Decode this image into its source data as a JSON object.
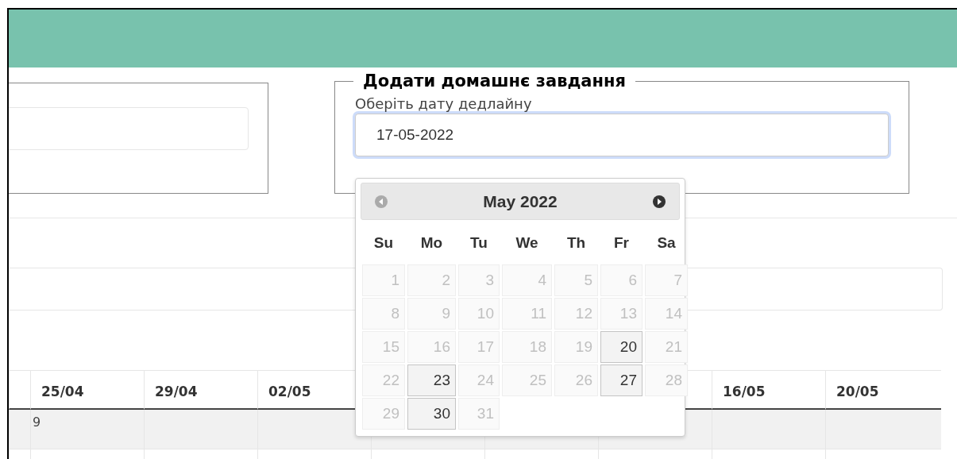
{
  "form": {
    "legend": "Додати домашнє завдання",
    "label": "Оберіть дату дедлайну",
    "date_value": "17-05-2022"
  },
  "datepicker": {
    "title": "May 2022",
    "prev_disabled": true,
    "next_disabled": false,
    "weekdays": [
      "Su",
      "Mo",
      "Tu",
      "We",
      "Th",
      "Fr",
      "Sa"
    ],
    "days": [
      {
        "label": "1",
        "enabled": false
      },
      {
        "label": "2",
        "enabled": false
      },
      {
        "label": "3",
        "enabled": false
      },
      {
        "label": "4",
        "enabled": false
      },
      {
        "label": "5",
        "enabled": false
      },
      {
        "label": "6",
        "enabled": false
      },
      {
        "label": "7",
        "enabled": false
      },
      {
        "label": "8",
        "enabled": false
      },
      {
        "label": "9",
        "enabled": false
      },
      {
        "label": "10",
        "enabled": false
      },
      {
        "label": "11",
        "enabled": false
      },
      {
        "label": "12",
        "enabled": false
      },
      {
        "label": "13",
        "enabled": false
      },
      {
        "label": "14",
        "enabled": false
      },
      {
        "label": "15",
        "enabled": false
      },
      {
        "label": "16",
        "enabled": false
      },
      {
        "label": "17",
        "enabled": false
      },
      {
        "label": "18",
        "enabled": false
      },
      {
        "label": "19",
        "enabled": false
      },
      {
        "label": "20",
        "enabled": true
      },
      {
        "label": "21",
        "enabled": false
      },
      {
        "label": "22",
        "enabled": false
      },
      {
        "label": "23",
        "enabled": true
      },
      {
        "label": "24",
        "enabled": false
      },
      {
        "label": "25",
        "enabled": false
      },
      {
        "label": "26",
        "enabled": false
      },
      {
        "label": "27",
        "enabled": true
      },
      {
        "label": "28",
        "enabled": false
      },
      {
        "label": "29",
        "enabled": false
      },
      {
        "label": "30",
        "enabled": true
      },
      {
        "label": "31",
        "enabled": false
      }
    ]
  },
  "table": {
    "columns": [
      "25/04",
      "29/04",
      "02/05",
      "16/05",
      "20/05"
    ],
    "rows": [
      {
        "cells": [
          "9"
        ]
      }
    ]
  }
}
